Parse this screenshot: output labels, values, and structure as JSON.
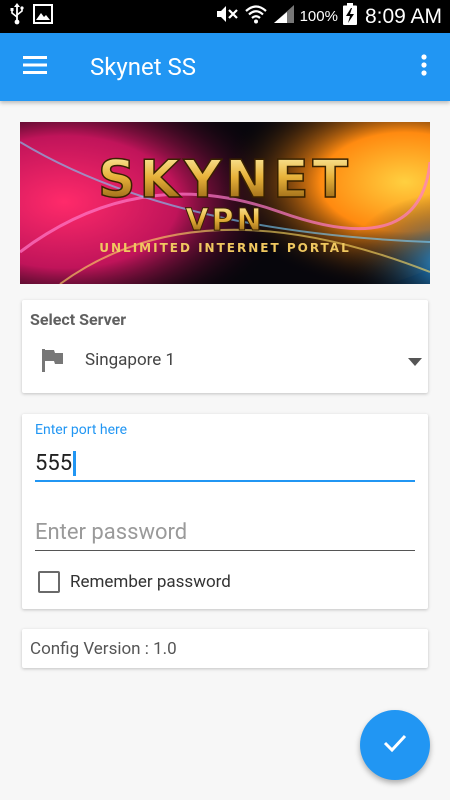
{
  "status_bar": {
    "battery_percent": "100%",
    "time": "8:09 AM",
    "icons": [
      "usb-icon",
      "image-icon",
      "mute-icon",
      "wifi-icon",
      "signal-icon",
      "battery-charging-icon"
    ]
  },
  "app_bar": {
    "title": "Skynet SS",
    "color": "#2196f3",
    "menu_icon": "hamburger-icon",
    "overflow_icon": "more-vertical-icon"
  },
  "banner": {
    "brand": "SKYNET",
    "sub": "VPN",
    "tagline": "UNLIMITED INTERNET PORTAL"
  },
  "server": {
    "label": "Select Server",
    "selected": "Singapore 1",
    "icon": "flag-icon"
  },
  "port": {
    "label": "Enter port here",
    "value": "555"
  },
  "password": {
    "placeholder": "Enter password",
    "value": ""
  },
  "remember": {
    "label": "Remember password",
    "checked": false
  },
  "config": {
    "text": "Config Version : 1.0"
  },
  "fab": {
    "icon": "check-icon",
    "color": "#2196f3"
  }
}
